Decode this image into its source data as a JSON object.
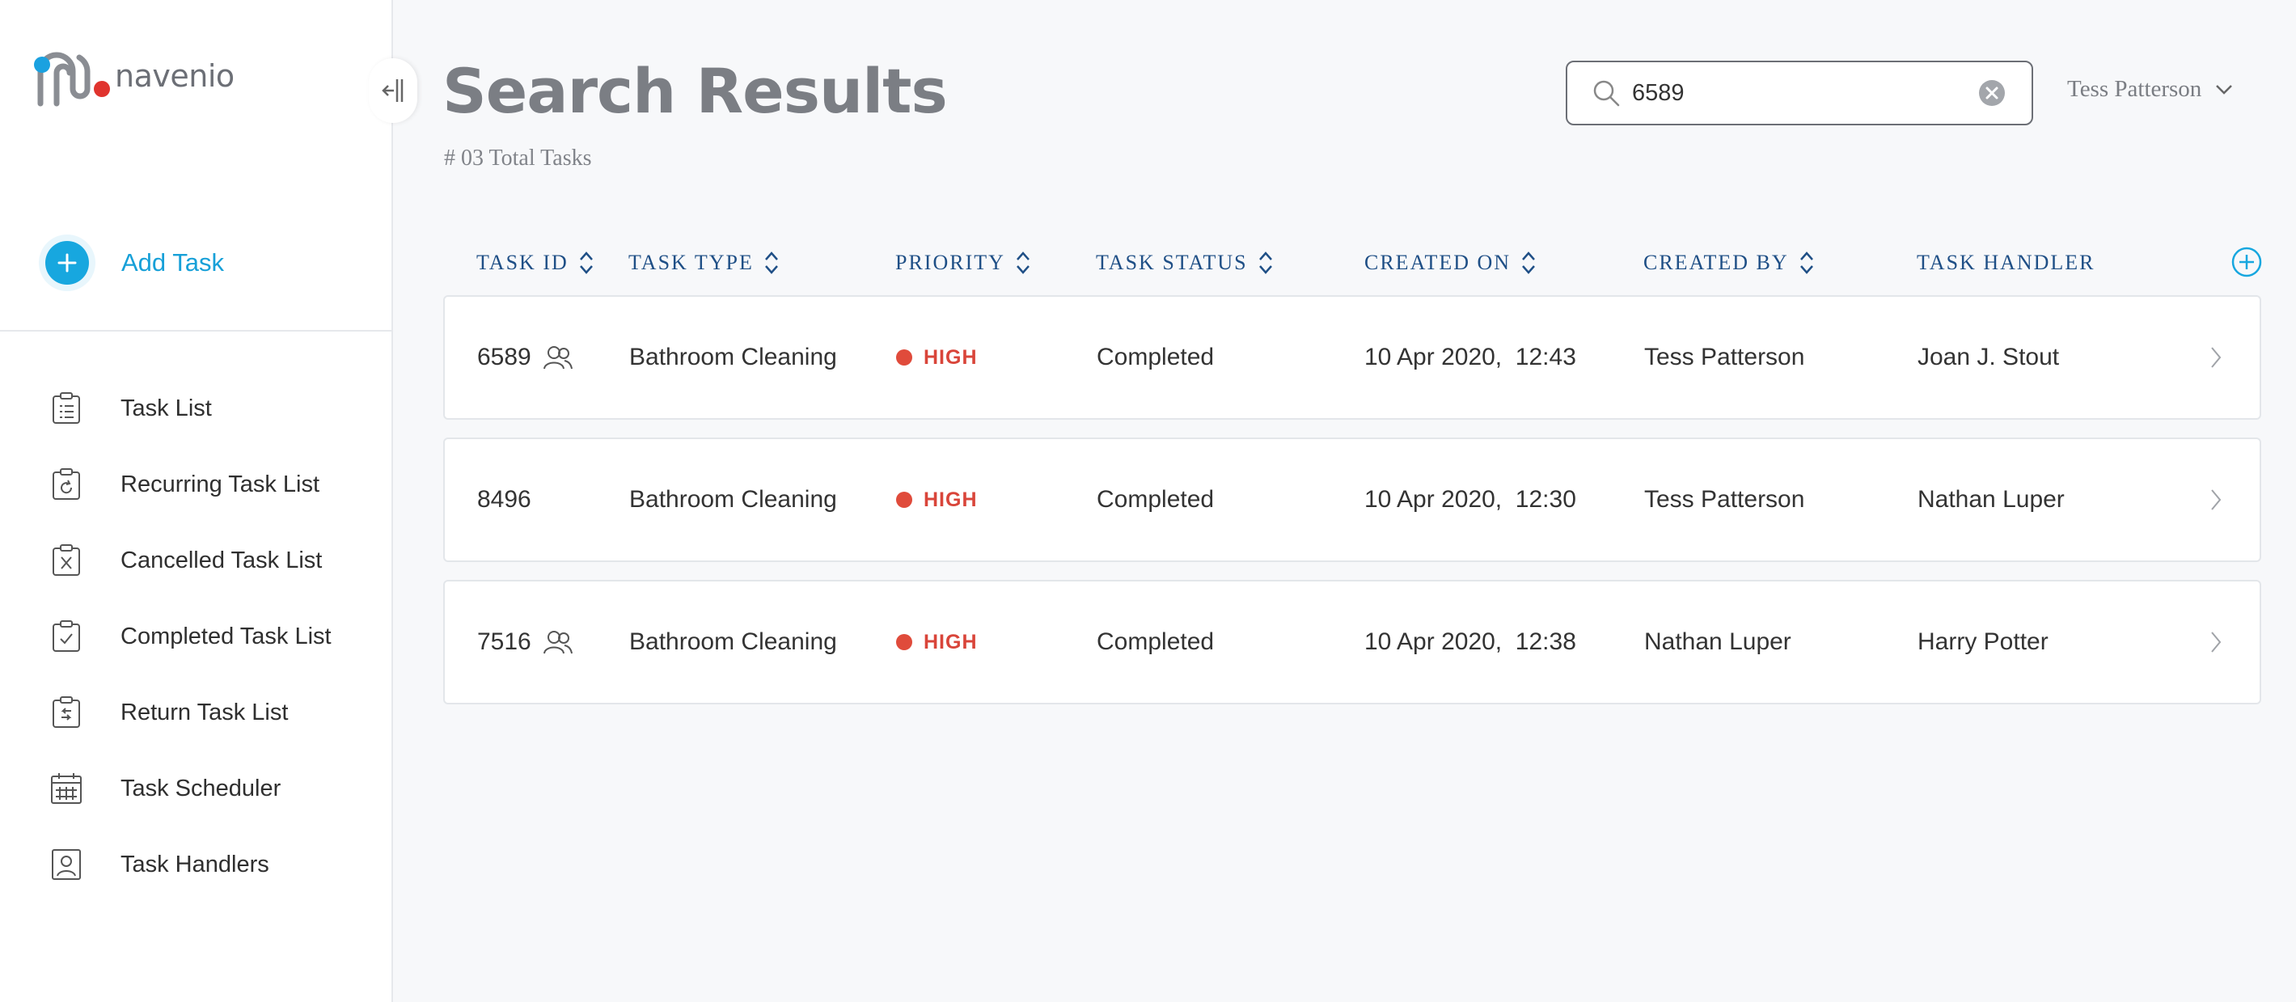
{
  "brand": {
    "name": "navenio",
    "accent": "#17a7df",
    "logo_blue": "#1aa1e0",
    "logo_red": "#e0342e"
  },
  "sidebar": {
    "add_task_label": "Add Task",
    "items": [
      {
        "label": "Task List",
        "icon": "clipboard-list-icon"
      },
      {
        "label": "Recurring Task List",
        "icon": "clipboard-recurring-icon"
      },
      {
        "label": "Cancelled Task List",
        "icon": "clipboard-cancel-icon"
      },
      {
        "label": "Completed Task List",
        "icon": "clipboard-check-icon"
      },
      {
        "label": "Return Task List",
        "icon": "clipboard-return-icon"
      },
      {
        "label": "Task Scheduler",
        "icon": "calendar-icon"
      },
      {
        "label": "Task Handlers",
        "icon": "user-badge-icon"
      }
    ]
  },
  "header": {
    "title": "Search Results",
    "subtitle": "# 03 Total Tasks",
    "search": {
      "value": "6589",
      "placeholder": ""
    },
    "user": "Tess Patterson"
  },
  "table": {
    "columns": [
      "TASK ID",
      "TASK TYPE",
      "PRIORITY",
      "TASK STATUS",
      "CREATED ON",
      "CREATED BY",
      "TASK HANDLER"
    ],
    "rows": [
      {
        "id": "6589",
        "team": true,
        "type": "Bathroom Cleaning",
        "priority": "HIGH",
        "status": "Completed",
        "created_on": "10 Apr 2020,  12:43",
        "created_by": "Tess Patterson",
        "handler": "Joan J. Stout"
      },
      {
        "id": "8496",
        "team": false,
        "type": "Bathroom Cleaning",
        "priority": "HIGH",
        "status": "Completed",
        "created_on": "10 Apr 2020,  12:30",
        "created_by": "Tess Patterson",
        "handler": "Nathan Luper"
      },
      {
        "id": "7516",
        "team": true,
        "type": "Bathroom Cleaning",
        "priority": "HIGH",
        "status": "Completed",
        "created_on": "10 Apr 2020,  12:38",
        "created_by": "Nathan Luper",
        "handler": "Harry Potter"
      }
    ]
  },
  "colors": {
    "header_text": "#1f4f86",
    "priority_high": "#d9453a"
  }
}
